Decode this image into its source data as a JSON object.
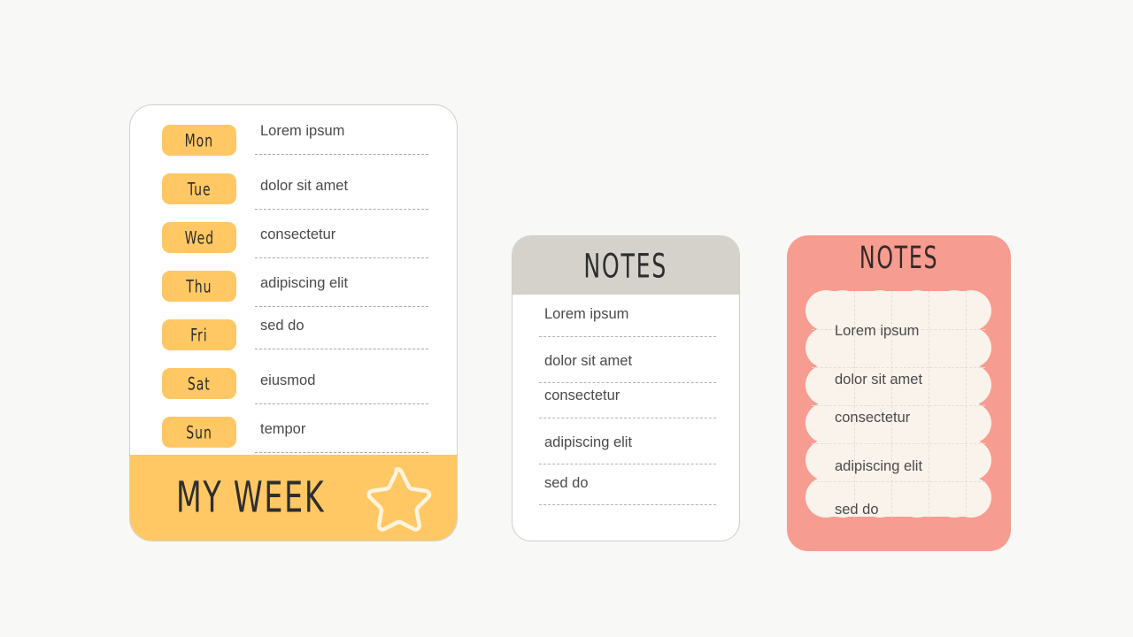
{
  "background_color": "#F8F8F7",
  "colors": {
    "yellow": "#FFC864",
    "gray_header": "#D5D2CB",
    "pink": "#F79C90",
    "cream": "#FAF3EC",
    "text_dark": "#2E2E2E",
    "text_body": "#4A4A4A",
    "dashed_line": "#A9A9A9",
    "card_border": "#CFCFCF"
  },
  "planner": {
    "title": "MY WEEK",
    "star_icon": "star-icon",
    "rows": [
      {
        "day": "Mon",
        "task": "Lorem ipsum"
      },
      {
        "day": "Tue",
        "task": "dolor sit amet"
      },
      {
        "day": "Wed",
        "task": "consectetur"
      },
      {
        "day": "Thu",
        "task": "adipiscing elit"
      },
      {
        "day": "Fri",
        "task": "sed do"
      },
      {
        "day": "Sat",
        "task": "eiusmod"
      },
      {
        "day": "Sun",
        "task": "tempor"
      }
    ]
  },
  "notes_card": {
    "title": "NOTES",
    "rows": [
      {
        "text": "Lorem ipsum"
      },
      {
        "text": "dolor sit amet"
      },
      {
        "text": "consectetur"
      },
      {
        "text": "adipiscing elit"
      },
      {
        "text": "sed do"
      }
    ]
  },
  "scallop_card": {
    "title": "NOTES",
    "rows": [
      {
        "text": "Lorem ipsum"
      },
      {
        "text": "dolor sit amet"
      },
      {
        "text": "consectetur"
      },
      {
        "text": "adipiscing elit"
      },
      {
        "text": "sed do"
      }
    ]
  }
}
